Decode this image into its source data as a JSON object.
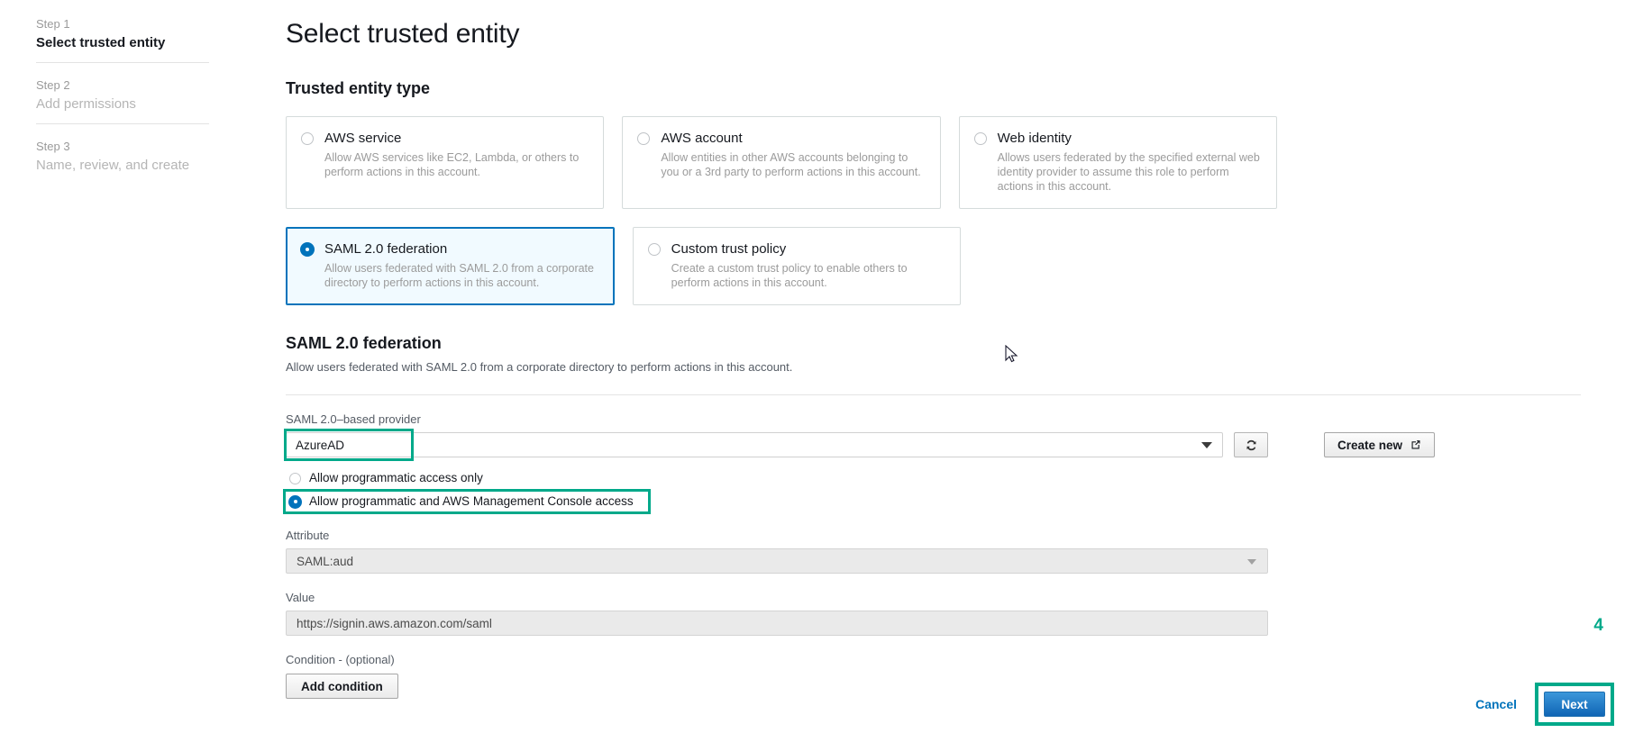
{
  "sidebar": {
    "steps": [
      {
        "num": "Step 1",
        "label": "Select trusted entity",
        "state": "active"
      },
      {
        "num": "Step 2",
        "label": "Add permissions",
        "state": "inactive"
      },
      {
        "num": "Step 3",
        "label": "Name, review, and create",
        "state": "inactive"
      }
    ]
  },
  "main": {
    "page_title": "Select trusted entity",
    "entity_section_title": "Trusted entity type",
    "tiles": [
      {
        "title": "AWS service",
        "desc": "Allow AWS services like EC2, Lambda, or others to perform actions in this account.",
        "selected": false
      },
      {
        "title": "AWS account",
        "desc": "Allow entities in other AWS accounts belonging to you or a 3rd party to perform actions in this account.",
        "selected": false
      },
      {
        "title": "Web identity",
        "desc": "Allows users federated by the specified external web identity provider to assume this role to perform actions in this account.",
        "selected": false
      },
      {
        "title": "SAML 2.0 federation",
        "desc": "Allow users federated with SAML 2.0 from a corporate directory to perform actions in this account.",
        "selected": true
      },
      {
        "title": "Custom trust policy",
        "desc": "Create a custom trust policy to enable others to perform actions in this account.",
        "selected": false
      }
    ],
    "federation": {
      "heading": "SAML 2.0 federation",
      "subtext": "Allow users federated with SAML 2.0 from a corporate directory to perform actions in this account.",
      "provider_label": "SAML 2.0–based provider",
      "provider_value": "AzureAD",
      "refresh_icon": "refresh-icon",
      "create_new_label": "Create new",
      "create_new_icon": "external-link-icon",
      "access_options": [
        {
          "label": "Allow programmatic access only",
          "selected": false,
          "highlighted": false
        },
        {
          "label": "Allow programmatic and AWS Management Console access",
          "selected": true,
          "highlighted": true
        }
      ],
      "attribute_label": "Attribute",
      "attribute_value": "SAML:aud",
      "value_label": "Value",
      "value_value": "https://signin.aws.amazon.com/saml",
      "condition_label": "Condition - (optional)",
      "add_condition_label": "Add condition"
    }
  },
  "footer": {
    "step_badge": "4",
    "cancel_label": "Cancel",
    "next_label": "Next"
  },
  "colors": {
    "accent_blue": "#0073bb",
    "highlight_green": "#00a98a",
    "muted_text": "#9b9b9b"
  }
}
